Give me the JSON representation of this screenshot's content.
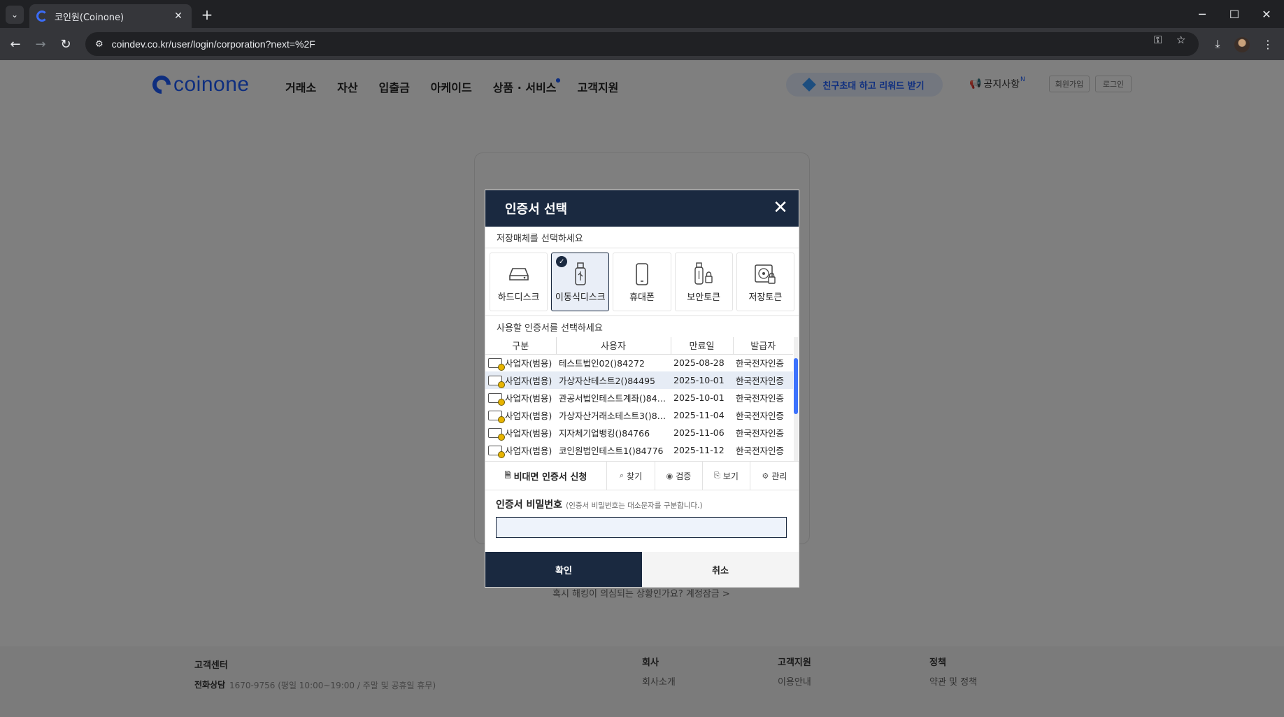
{
  "browser": {
    "tab_title": "코인원(Coinone)",
    "tab_close": "✕",
    "new_tab": "+",
    "url": "coindev.co.kr/user/login/corporation?next=%2F"
  },
  "site": {
    "logo_text": "coinone",
    "nav": [
      "거래소",
      "자산",
      "입출금",
      "아케이드",
      "상품 · 서비스",
      "고객지원"
    ],
    "invite_banner": "친구초대 하고 리워드 받기",
    "notice": "공지사항",
    "notice_badge": "N",
    "signup": "회원가입",
    "login": "로그인",
    "hack_link": "혹시 해킹이 의심되는 상황인가요? 계정잠금 >"
  },
  "footer": {
    "cs_title": "고객센터",
    "cs_phone_label": "전화상담",
    "cs_phone": "1670-9756 (평일 10:00~19:00 / 주말 및 공휴일 휴무)",
    "company_title": "회사",
    "company_link": "회사소개",
    "support_title": "고객지원",
    "support_link": "이용안내",
    "policy_title": "정책",
    "policy_link": "약관 및 정책"
  },
  "modal": {
    "title": "인증서 선택",
    "close": "✕",
    "media_prompt": "저장매체를 선택하세요",
    "media": [
      {
        "label": "하드디스크",
        "icon": "hard-disk-icon",
        "selected": false
      },
      {
        "label": "이동식디스크",
        "icon": "usb-drive-icon",
        "selected": true
      },
      {
        "label": "휴대폰",
        "icon": "mobile-phone-icon",
        "selected": false
      },
      {
        "label": "보안토큰",
        "icon": "security-token-icon",
        "selected": false
      },
      {
        "label": "저장토큰",
        "icon": "storage-token-icon",
        "selected": false
      }
    ],
    "cert_prompt": "사용할 인증서를 선택하세요",
    "columns": [
      "구분",
      "사용자",
      "만료일",
      "발급자"
    ],
    "certs": [
      {
        "type": "사업자(범용)",
        "user": "테스트법인02()84272",
        "expiry": "2025-08-28",
        "issuer": "한국전자인증"
      },
      {
        "type": "사업자(범용)",
        "user": "가상자산테스트2()84495",
        "expiry": "2025-10-01",
        "issuer": "한국전자인증"
      },
      {
        "type": "사업자(범용)",
        "user": "관공서법인테스트계좌()84…",
        "expiry": "2025-10-01",
        "issuer": "한국전자인증"
      },
      {
        "type": "사업자(범용)",
        "user": "가상자산거래소테스트3()8…",
        "expiry": "2025-11-04",
        "issuer": "한국전자인증"
      },
      {
        "type": "사업자(범용)",
        "user": "지자체기업뱅킹()84766",
        "expiry": "2025-11-06",
        "issuer": "한국전자인증"
      },
      {
        "type": "사업자(범용)",
        "user": "코인원법인테스트1()84776",
        "expiry": "2025-11-12",
        "issuer": "한국전자인증"
      }
    ],
    "selected_row": 1,
    "actions": {
      "apply": "비대면 인증서 신청",
      "find": "찾기",
      "verify": "검증",
      "view": "보기",
      "manage": "관리"
    },
    "password_label": "인증서 비밀번호",
    "password_hint": "(인증서 비밀번호는 대소문자를 구분합니다.)",
    "password_value": "",
    "ok": "확인",
    "cancel": "취소"
  },
  "colors": {
    "brand": "#1c5cff",
    "modal_header": "#1a2940",
    "selected_row": "#e6ecf5"
  }
}
